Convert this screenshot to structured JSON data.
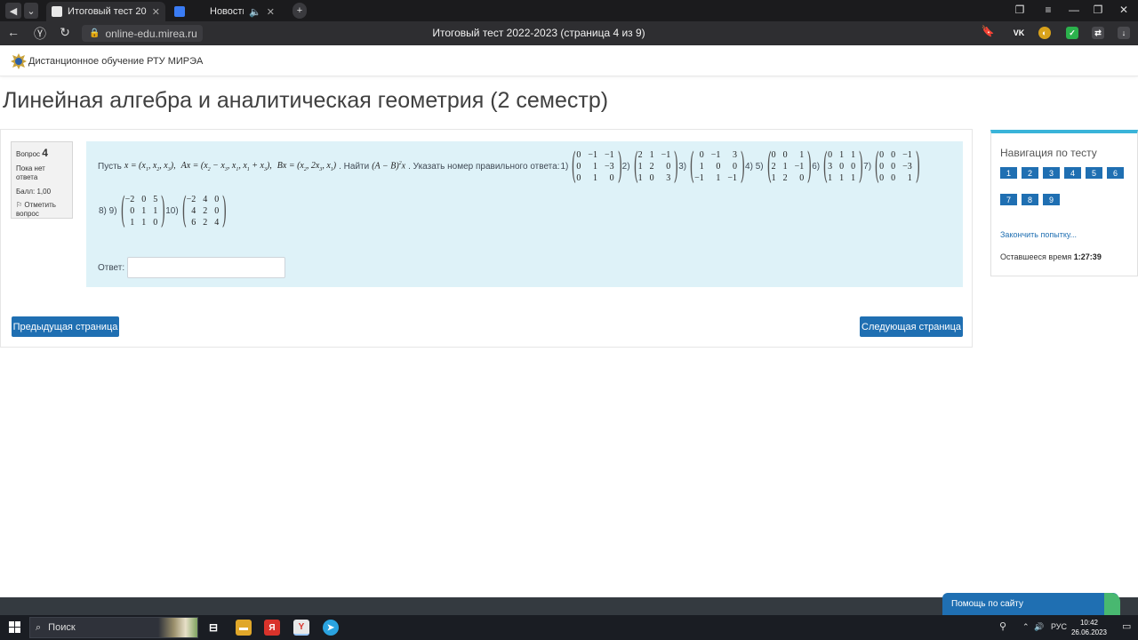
{
  "browser": {
    "tabs": [
      {
        "title": "Итоговый тест 2022-20",
        "active": true
      },
      {
        "title": "Новости",
        "active": false
      }
    ],
    "url": "online-edu.mirea.ru",
    "page_title": "Итоговый тест 2022-2023 (страница 4 из 9)"
  },
  "site": {
    "name": "Дистанционное обучение РТУ МИРЭА"
  },
  "course_title": "Линейная алгебра и аналитическая геометрия (2 семестр)",
  "question_info": {
    "label": "Вопрос",
    "number": "4",
    "status": "Пока нет ответа",
    "score": "Балл: 1,00",
    "flag": "Отметить вопрос"
  },
  "question": {
    "prefix": "Пусть",
    "find": ". Найти",
    "instruction": ". Указать номер правильного ответа:",
    "options_row1": [
      {
        "label": "1)",
        "m": [
          "0",
          "−1",
          "−1",
          "0",
          "1",
          "−3",
          "0",
          "1",
          "0"
        ]
      },
      {
        "label": "2)",
        "m": [
          "2",
          "1",
          "−1",
          "1",
          "2",
          "0",
          "1",
          "0",
          "3"
        ]
      },
      {
        "label": "3)",
        "m": [
          "0",
          "−1",
          "3",
          "1",
          "0",
          "0",
          "−1",
          "1",
          "−1"
        ]
      },
      {
        "label": "4) 5)",
        "m": [
          "0",
          "0",
          "1",
          "2",
          "1",
          "−1",
          "1",
          "2",
          "0"
        ]
      },
      {
        "label": "6)",
        "m": [
          "0",
          "1",
          "1",
          "3",
          "0",
          "0",
          "1",
          "1",
          "1"
        ]
      },
      {
        "label": "7)",
        "m": [
          "0",
          "0",
          "−1",
          "0",
          "0",
          "−3",
          "0",
          "0",
          "1"
        ]
      }
    ],
    "options_row2": [
      {
        "label": "8) 9)",
        "m": [
          "−2",
          "0",
          "5",
          "0",
          "1",
          "1",
          "1",
          "1",
          "0"
        ]
      },
      {
        "label": "10)",
        "m": [
          "−2",
          "4",
          "0",
          "4",
          "2",
          "0",
          "6",
          "2",
          "4"
        ]
      }
    ],
    "answer_label": "Ответ:",
    "answer_value": ""
  },
  "buttons": {
    "prev": "Предыдущая страница",
    "next": "Следующая страница"
  },
  "quiz_nav": {
    "title": "Навигация по тесту",
    "pages": [
      "1",
      "2",
      "3",
      "4",
      "5",
      "6",
      "7",
      "8",
      "9"
    ],
    "finish": "Закончить попытку...",
    "time_label": "Оставшееся время",
    "time_value": "1:27:39"
  },
  "help": "Помощь по сайту",
  "taskbar": {
    "search": "Поиск",
    "lang": "РУС",
    "time": "10:42",
    "date": "26.06.2023"
  }
}
